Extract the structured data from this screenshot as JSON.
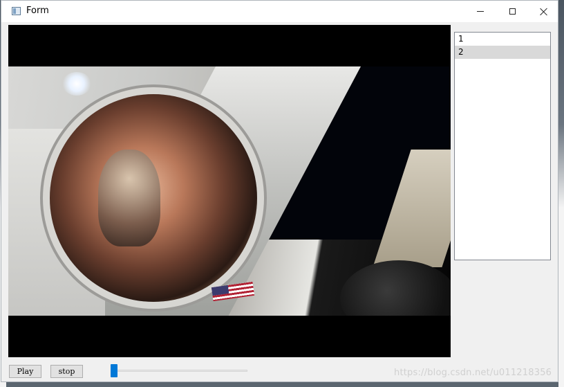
{
  "window": {
    "title": "Form",
    "controls": {
      "minimize": "minimize-icon",
      "maximize": "maximize-icon",
      "close": "close-icon"
    }
  },
  "video": {
    "content": "astronaut helmet selfie in space"
  },
  "list": {
    "items": [
      "1",
      "2"
    ],
    "selected_index": 1
  },
  "controls": {
    "play_label": "Play",
    "stop_label": "stop"
  },
  "slider": {
    "value_percent": 0
  },
  "watermark": "https://blog.csdn.net/u011218356",
  "colors": {
    "accent": "#0078d7",
    "selection": "#d9d9d9"
  }
}
